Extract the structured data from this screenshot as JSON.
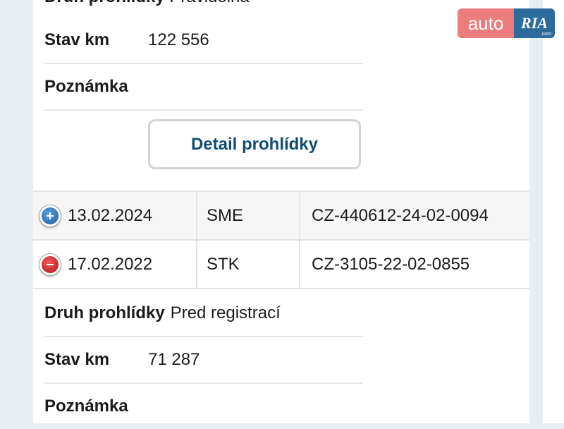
{
  "inspection_top": {
    "partial_label": "Druh prohlídky",
    "partial_value": "Pravidelná",
    "mileage_label": "Stav km",
    "mileage_value": "122 556",
    "note_label": "Poznámka",
    "detail_button": "Detail prohlídky"
  },
  "table": {
    "rows": [
      {
        "date": "13.02.2024",
        "type": "SME",
        "number": "CZ-440612-24-02-0094",
        "toggle_icon": "plus-icon",
        "expanded": false
      },
      {
        "date": "17.02.2022",
        "type": "STK",
        "number": "CZ-3105-22-02-0855",
        "toggle_icon": "minus-icon",
        "expanded": true
      }
    ]
  },
  "inspection_bottom": {
    "type_label": "Druh prohlídky",
    "type_value": "Pred registrací",
    "mileage_label": "Stav km",
    "mileage_value": "71 287",
    "note_label": "Poznámka"
  },
  "watermark": {
    "part1": "auto",
    "part2": "RIA",
    "domain": ".com"
  },
  "colors": {
    "button_text": "#0d4d72",
    "plus_toggle": "#1e5fa3",
    "minus_toggle": "#b41414",
    "watermark_auto": "#ec7d7d",
    "watermark_ria": "#2d6b9c"
  }
}
